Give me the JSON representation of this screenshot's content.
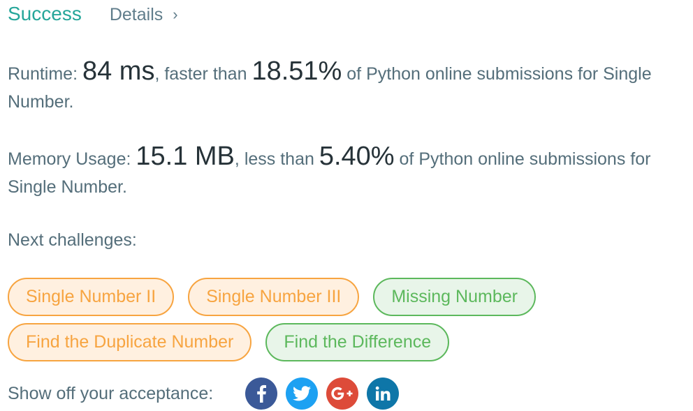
{
  "header": {
    "status": "Success",
    "details_label": "Details",
    "details_chevron": "›"
  },
  "runtime": {
    "label": "Runtime: ",
    "value": "84 ms",
    "faster_text": ", faster than ",
    "percent": "18.51%",
    "tail": " of Python online submissions for Single Number."
  },
  "memory": {
    "label": "Memory Usage: ",
    "value": "15.1 MB",
    "less_text": ", less than ",
    "percent": "5.40%",
    "tail": " of Python online submissions for Single Number."
  },
  "next": {
    "label": "Next challenges:",
    "challenges": [
      {
        "title": "Single Number II",
        "difficulty_color": "#f7a440"
      },
      {
        "title": "Single Number III",
        "difficulty_color": "#f7a440"
      },
      {
        "title": "Missing Number",
        "difficulty_color": "#5cb85c"
      },
      {
        "title": "Find the Duplicate Number",
        "difficulty_color": "#f7a440"
      },
      {
        "title": "Find the Difference",
        "difficulty_color": "#5cb85c"
      }
    ]
  },
  "share": {
    "label": "Show off your acceptance:",
    "icons": [
      {
        "name": "facebook-icon",
        "color": "#3b5998"
      },
      {
        "name": "twitter-icon",
        "color": "#1da1f2"
      },
      {
        "name": "google-plus-icon",
        "color": "#dd4b39"
      },
      {
        "name": "linkedin-icon",
        "color": "#0e76a8"
      }
    ]
  },
  "colors": {
    "success": "#26a69a",
    "medium": "#f7a440",
    "easy": "#5cb85c"
  }
}
